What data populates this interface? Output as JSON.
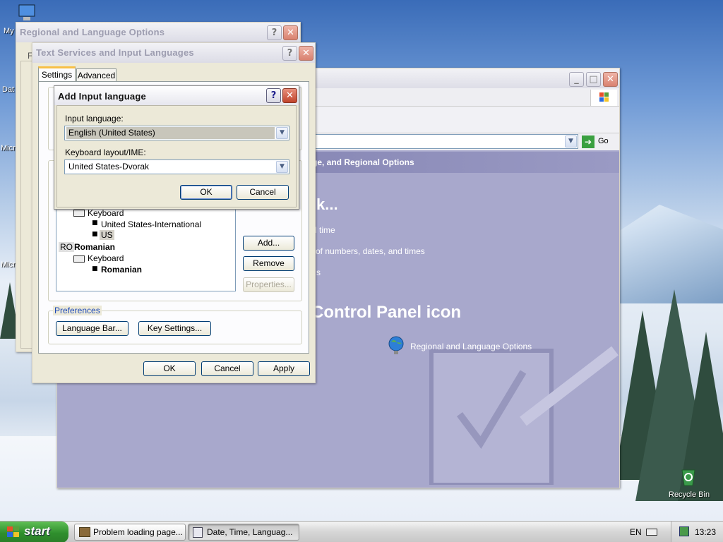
{
  "desktop": {
    "icons": [
      {
        "label": "My"
      },
      {
        "label": "Dat"
      },
      {
        "label": "Micr"
      },
      {
        "label": "Micr"
      },
      {
        "label": "Recycle Bin"
      }
    ]
  },
  "control_panel": {
    "address_go": "Go",
    "header_text": "ge, and Regional Options",
    "pick_task_heading": "k...",
    "tasks": [
      "d time",
      "of numbers, dates, and times",
      "s"
    ],
    "pick_icon_heading": "Control Panel icon",
    "icon_label": "Regional and Language Options"
  },
  "regional_window": {
    "title": "Regional and Language Options",
    "tab_stub": "F"
  },
  "text_services": {
    "title": "Text Services and Input Languages",
    "tabs": [
      "Settings",
      "Advanced"
    ],
    "languages": [
      {
        "type": "keyboard",
        "label": "Keyboard"
      },
      {
        "type": "layout",
        "label": "United States-International"
      },
      {
        "type": "layout",
        "label": "US",
        "selected": true
      },
      {
        "type": "lang",
        "code": "RO",
        "label": "Romanian"
      },
      {
        "type": "keyboard",
        "label": "Keyboard"
      },
      {
        "type": "layout",
        "label": "Romanian",
        "bold": true
      }
    ],
    "buttons": {
      "add": "Add...",
      "remove": "Remove",
      "properties": "Properties..."
    },
    "preferences": {
      "legend": "Preferences",
      "language_bar": "Language Bar...",
      "key_settings": "Key Settings..."
    },
    "footer": {
      "ok": "OK",
      "cancel": "Cancel",
      "apply": "Apply"
    }
  },
  "add_input_language": {
    "title": "Add Input language",
    "input_language_label": "Input language:",
    "input_language_value": "English (United States)",
    "keyboard_label": "Keyboard layout/IME:",
    "keyboard_value": "United States-Dvorak",
    "ok": "OK",
    "cancel": "Cancel"
  },
  "taskbar": {
    "start": "start",
    "tasks": [
      {
        "label": "Problem loading page...",
        "active": false
      },
      {
        "label": "Date, Time, Languag...",
        "active": true
      }
    ],
    "language_indicator": "EN",
    "clock": "13:23"
  },
  "colors": {
    "xp_blue": "#0a246a",
    "start_green": "#3c9c3a",
    "dialog_bg": "#ece9d8",
    "cp_bg": "#a8a8cc"
  }
}
